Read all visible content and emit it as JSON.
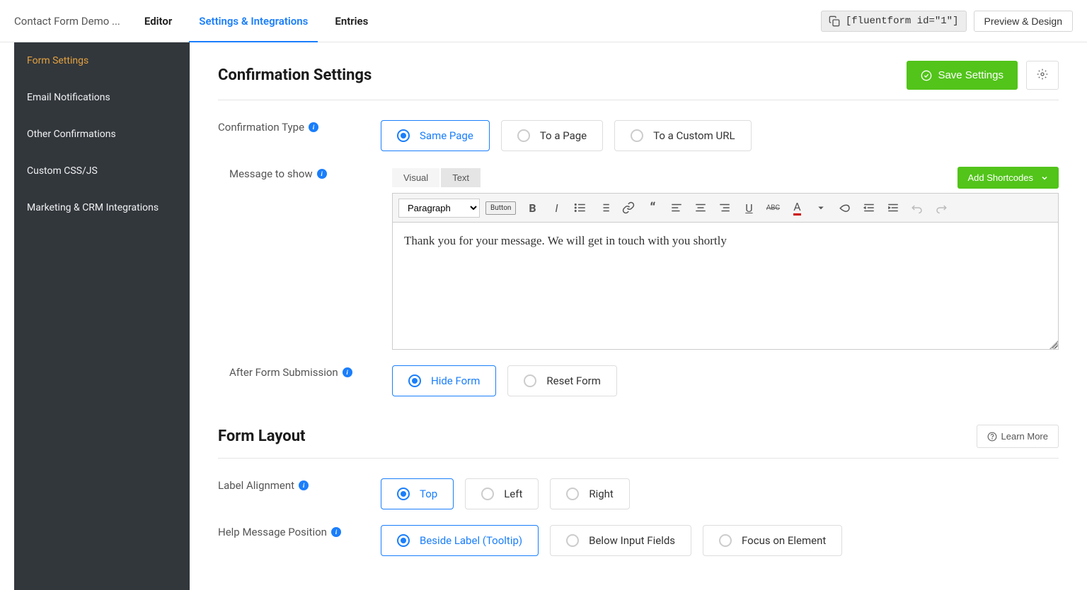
{
  "topbar": {
    "form_title": "Contact Form Demo ...",
    "links": {
      "editor": "Editor",
      "settings": "Settings & Integrations",
      "entries": "Entries"
    },
    "shortcode": "[fluentform id=\"1\"]",
    "preview": "Preview & Design"
  },
  "sidebar": {
    "items": [
      "Form Settings",
      "Email Notifications",
      "Other Confirmations",
      "Custom CSS/JS",
      "Marketing & CRM Integrations"
    ]
  },
  "sections": {
    "confirmation": {
      "title": "Confirmation Settings",
      "save": "Save Settings",
      "fields": {
        "confirmation_type": {
          "label": "Confirmation Type",
          "options": [
            "Same Page",
            "To a Page",
            "To a Custom URL"
          ],
          "selected": "Same Page"
        },
        "message": {
          "label": "Message to show",
          "tabs": [
            "Visual",
            "Text"
          ],
          "add_shortcodes": "Add Shortcodes",
          "paragraph": "Paragraph",
          "button_label": "Button",
          "content": "Thank you for your message. We will get in touch with you shortly"
        },
        "after_submission": {
          "label": "After Form Submission",
          "options": [
            "Hide Form",
            "Reset Form"
          ],
          "selected": "Hide Form"
        }
      }
    },
    "layout": {
      "title": "Form Layout",
      "learn_more": "Learn More",
      "fields": {
        "label_alignment": {
          "label": "Label Alignment",
          "options": [
            "Top",
            "Left",
            "Right"
          ],
          "selected": "Top"
        },
        "help_position": {
          "label": "Help Message Position",
          "options": [
            "Beside Label (Tooltip)",
            "Below Input Fields",
            "Focus on Element"
          ],
          "selected": "Beside Label (Tooltip)"
        }
      }
    }
  }
}
